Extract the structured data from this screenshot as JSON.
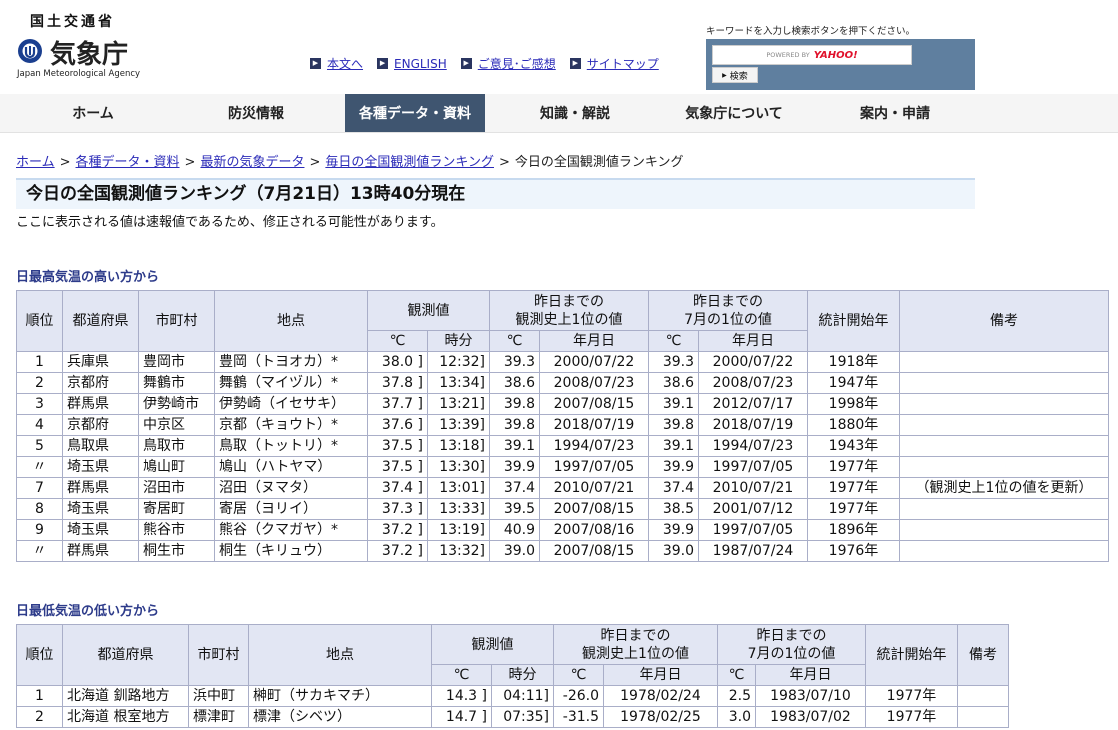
{
  "header": {
    "ministry": "国土交通省",
    "agency": "気象庁",
    "agency_en": "Japan Meteorological Agency",
    "links": [
      {
        "label": "本文へ",
        "icon": "arrow-right-icon"
      },
      {
        "label": "ENGLISH",
        "icon": "arrow-right-icon"
      },
      {
        "label": "ご意見･ご感想",
        "icon": "arrow-right-icon"
      },
      {
        "label": "サイトマップ",
        "icon": "arrow-right-icon"
      }
    ],
    "search": {
      "hint": "キーワードを入力し検索ボタンを押下ください。",
      "powered_by": "POWERED BY",
      "provider": "YAHOO!",
      "button": "検索"
    }
  },
  "nav": [
    {
      "label": "ホーム"
    },
    {
      "label": "防災情報"
    },
    {
      "label": "各種データ・資料",
      "active": true
    },
    {
      "label": "知識・解説"
    },
    {
      "label": "気象庁について"
    },
    {
      "label": "案内・申請"
    }
  ],
  "breadcrumb": [
    "ホーム",
    "各種データ・資料",
    "最新の気象データ",
    "毎日の全国観測値ランキング",
    "今日の全国観測値ランキング"
  ],
  "page": {
    "title": "今日の全国観測値ランキング（7月21日）13時40分現在",
    "notice": "ここに表示される値は速報値であるため、修正される可能性があります。"
  },
  "high_table": {
    "heading": "日最高気温の高い方から",
    "headers": {
      "rank": "順位",
      "pref": "都道府県",
      "city": "市町村",
      "station": "地点",
      "obs": "観測値",
      "hist": "昨日までの\n観測史上1位の値",
      "month": "昨日までの\n7月の1位の値",
      "start": "統計開始年",
      "note": "備考",
      "deg": "℃",
      "time": "時分",
      "date": "年月日"
    },
    "rows": [
      [
        "1",
        "兵庫県",
        "豊岡市",
        "豊岡（トヨオカ）*",
        "38.0 ]",
        "12:32]",
        "39.3",
        "2000/07/22",
        "39.3",
        "2000/07/22",
        "1918年",
        ""
      ],
      [
        "2",
        "京都府",
        "舞鶴市",
        "舞鶴（マイヅル）*",
        "37.8 ]",
        "13:34]",
        "38.6",
        "2008/07/23",
        "38.6",
        "2008/07/23",
        "1947年",
        ""
      ],
      [
        "3",
        "群馬県",
        "伊勢崎市",
        "伊勢崎（イセサキ）",
        "37.7 ]",
        "13:21]",
        "39.8",
        "2007/08/15",
        "39.1",
        "2012/07/17",
        "1998年",
        ""
      ],
      [
        "4",
        "京都府",
        "中京区",
        "京都（キョウト）*",
        "37.6 ]",
        "13:39]",
        "39.8",
        "2018/07/19",
        "39.8",
        "2018/07/19",
        "1880年",
        ""
      ],
      [
        "5",
        "鳥取県",
        "鳥取市",
        "鳥取（トットリ）*",
        "37.5 ]",
        "13:18]",
        "39.1",
        "1994/07/23",
        "39.1",
        "1994/07/23",
        "1943年",
        ""
      ],
      [
        "〃",
        "埼玉県",
        "鳩山町",
        "鳩山（ハトヤマ）",
        "37.5 ]",
        "13:30]",
        "39.9",
        "1997/07/05",
        "39.9",
        "1997/07/05",
        "1977年",
        ""
      ],
      [
        "7",
        "群馬県",
        "沼田市",
        "沼田（ヌマタ）",
        "37.4 ]",
        "13:01]",
        "37.4",
        "2010/07/21",
        "37.4",
        "2010/07/21",
        "1977年",
        "（観測史上1位の値を更新）"
      ],
      [
        "8",
        "埼玉県",
        "寄居町",
        "寄居（ヨリイ）",
        "37.3 ]",
        "13:33]",
        "39.5",
        "2007/08/15",
        "38.5",
        "2001/07/12",
        "1977年",
        ""
      ],
      [
        "9",
        "埼玉県",
        "熊谷市",
        "熊谷（クマガヤ）*",
        "37.2 ]",
        "13:19]",
        "40.9",
        "2007/08/16",
        "39.9",
        "1997/07/05",
        "1896年",
        ""
      ],
      [
        "〃",
        "群馬県",
        "桐生市",
        "桐生（キリュウ）",
        "37.2 ]",
        "13:32]",
        "39.0",
        "2007/08/15",
        "39.0",
        "1987/07/24",
        "1976年",
        ""
      ]
    ]
  },
  "low_table": {
    "heading": "日最低気温の低い方から",
    "rows": [
      [
        "1",
        "北海道 釧路地方",
        "浜中町",
        "榊町（サカキマチ）",
        "14.3 ]",
        "04:11]",
        "-26.0",
        "1978/02/24",
        "2.5",
        "1983/07/10",
        "1977年",
        ""
      ],
      [
        "2",
        "北海道 根室地方",
        "標津町",
        "標津（シベツ）",
        "14.7 ]",
        "07:35]",
        "-31.5",
        "1978/02/25",
        "3.0",
        "1983/07/02",
        "1977年",
        ""
      ]
    ]
  }
}
